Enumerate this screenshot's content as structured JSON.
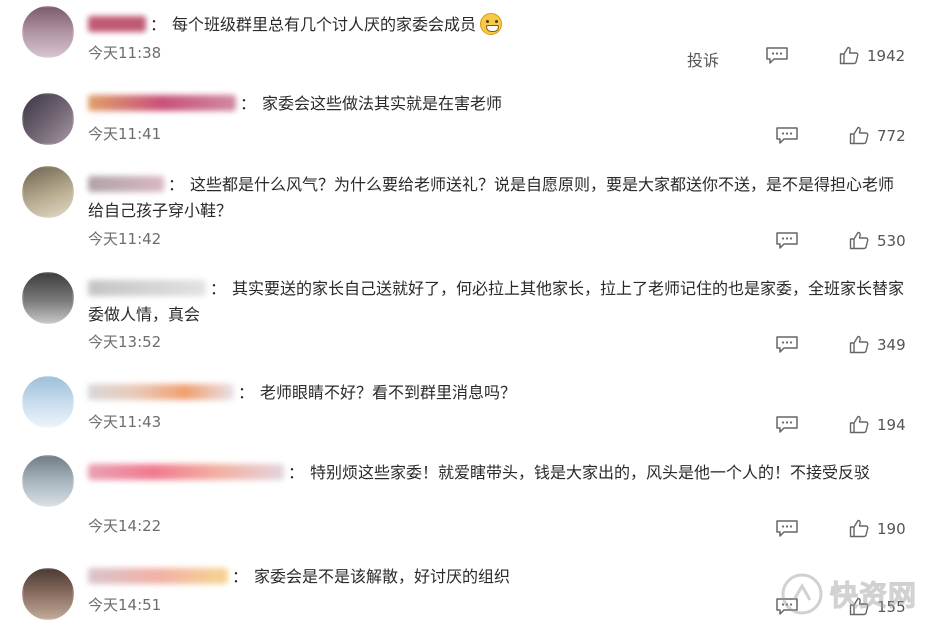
{
  "actions": {
    "report_label": "投诉"
  },
  "comments": [
    {
      "content": "每个班级群里总有几个讨人厌的家委会成员",
      "has_emoji": true,
      "time": "今天11:38",
      "likes": "1942",
      "avatar_colors": [
        "#7a5a6a",
        "#b59aa8",
        "#d8c6cf"
      ]
    },
    {
      "content": "家委会这些做法其实就是在害老师",
      "time": "今天11:41",
      "likes": "772",
      "avatar_colors": [
        "#3a3440",
        "#6e6270",
        "#a99aa6"
      ]
    },
    {
      "content": "这些都是什么风气？为什么要给老师送礼？说是自愿原则，要是大家都送你不送，是不是得担心老师给自己孩子穿小鞋？",
      "time": "今天11:42",
      "likes": "530",
      "avatar_colors": [
        "#6b6050",
        "#b8ab8f",
        "#e4dccb"
      ]
    },
    {
      "content": "其实要送的家长自己送就好了，何必拉上其他家长，拉上了老师记住的也是家委，全班家长替家委做人情，真会",
      "time": "今天13:52",
      "likes": "349",
      "avatar_colors": [
        "#3c3c3c",
        "#7a7a7a",
        "#c9c9c9"
      ]
    },
    {
      "content": "老师眼睛不好？看不到群里消息吗？",
      "time": "今天11:43",
      "likes": "194",
      "avatar_colors": [
        "#9dbfd9",
        "#c7dced",
        "#eef5fb"
      ]
    },
    {
      "content": "特别烦这些家委！就爱瞎带头，钱是大家出的，风头是他一个人的！不接受反驳",
      "time": "今天14:22",
      "likes": "190",
      "avatar_colors": [
        "#6e7c86",
        "#a7b4bd",
        "#dbe2e7"
      ]
    },
    {
      "content": "家委会是不是该解散，好讨厌的组织",
      "time": "今天14:51",
      "likes": "155",
      "avatar_colors": [
        "#4a3a34",
        "#8a6e60",
        "#c4ac9c"
      ]
    }
  ]
}
